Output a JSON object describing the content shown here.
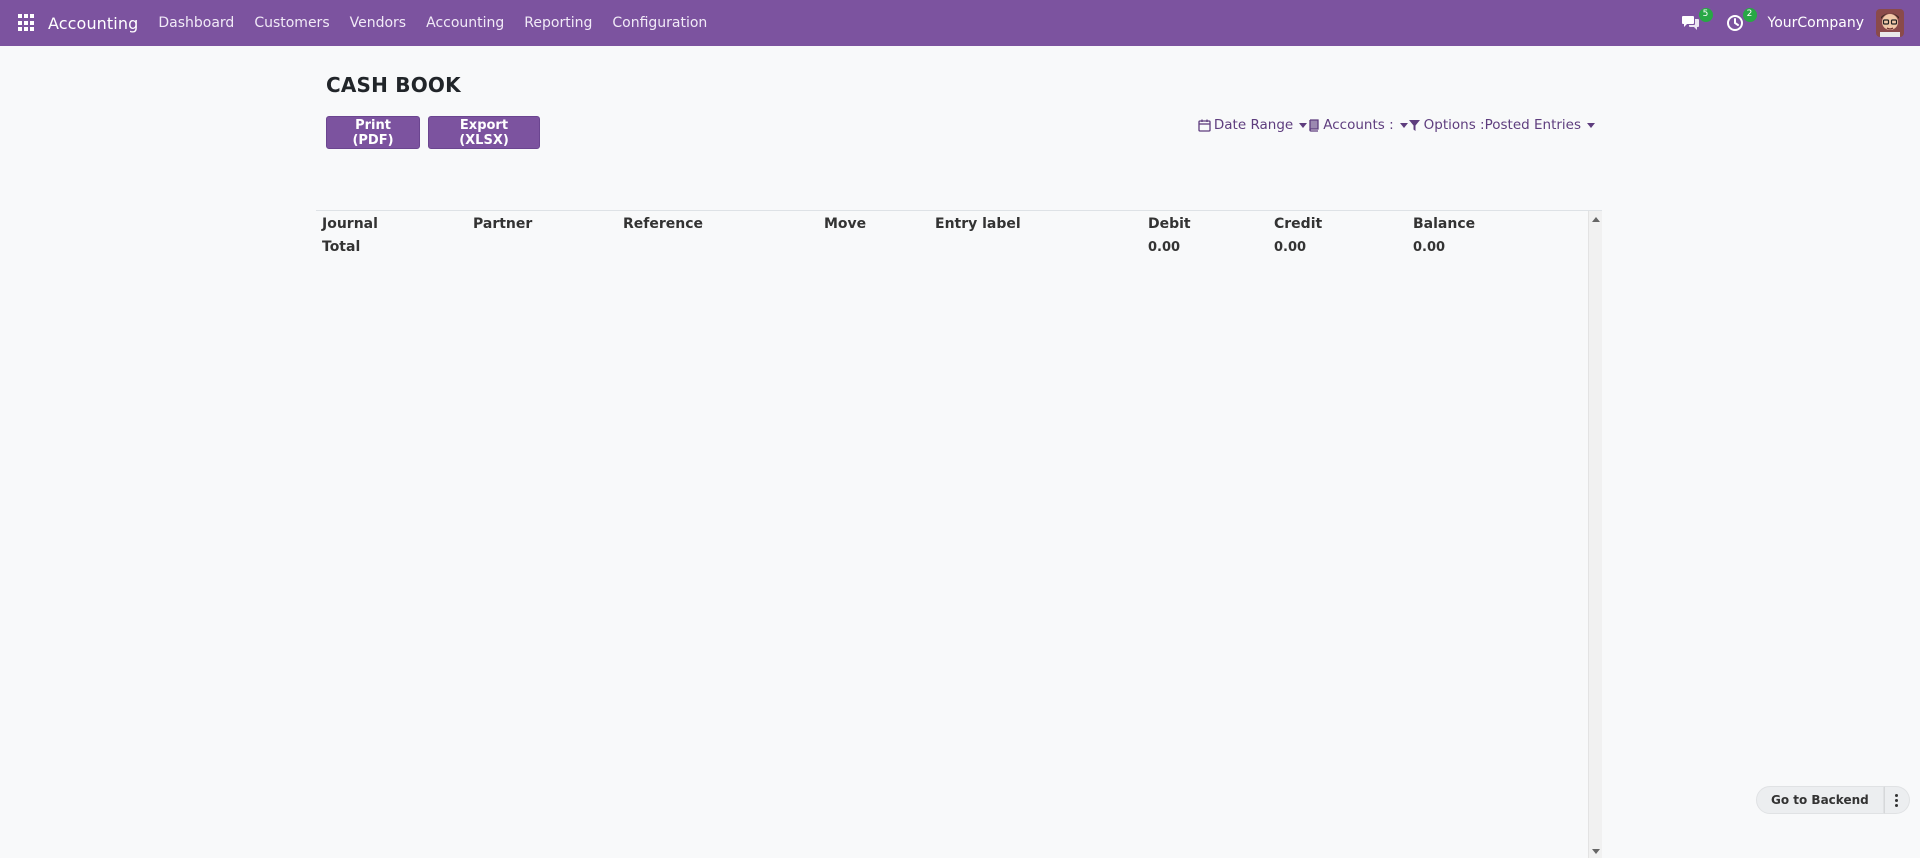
{
  "navbar": {
    "brand": "Accounting",
    "menu": [
      "Dashboard",
      "Customers",
      "Vendors",
      "Accounting",
      "Reporting",
      "Configuration"
    ],
    "messages_badge": "5",
    "activities_badge": "2",
    "company": "YourCompany",
    "color": "#7c539f"
  },
  "page": {
    "title": "CASH BOOK",
    "print_label": "Print (PDF)",
    "export_label": "Export (XLSX)"
  },
  "filters": {
    "date_range": "Date Range",
    "accounts": "Accounts :",
    "options": "Options :Posted Entries"
  },
  "table": {
    "columns": [
      "Journal",
      "Partner",
      "Reference",
      "Move",
      "Entry label",
      "Debit",
      "Credit",
      "Balance"
    ],
    "total_label": "Total",
    "total_debit": "0.00",
    "total_credit": "0.00",
    "total_balance": "0.00"
  },
  "widget": {
    "backend_label": "Go to Backend"
  }
}
